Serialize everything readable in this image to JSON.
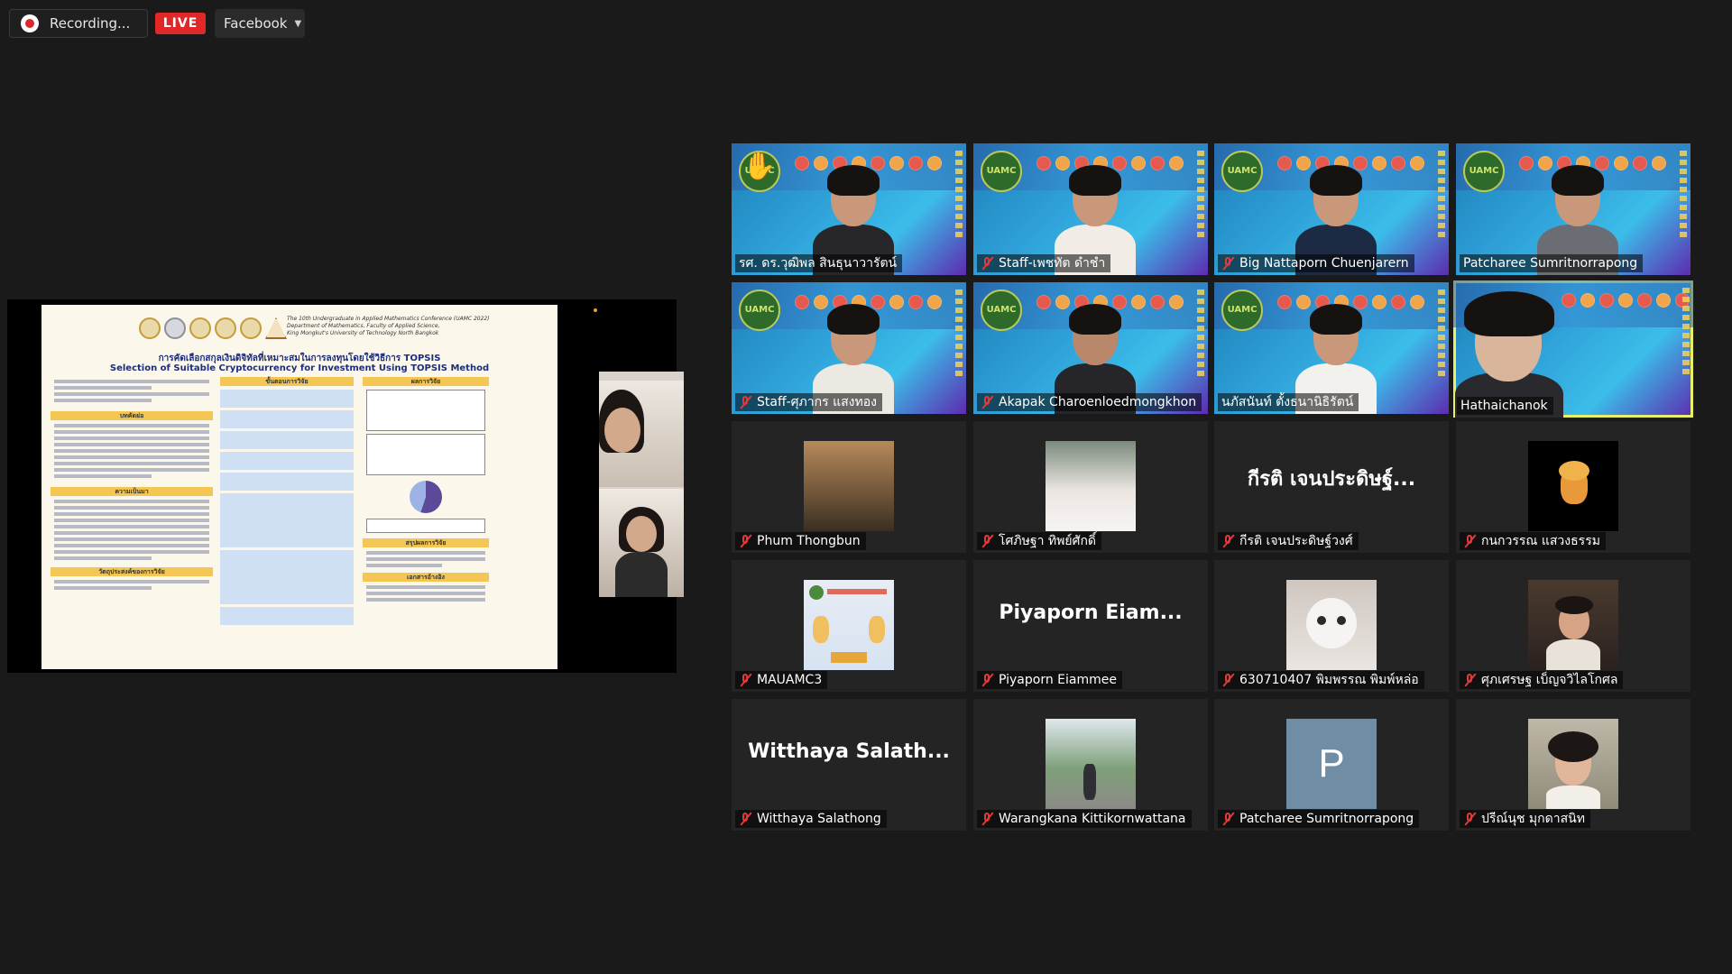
{
  "topbar": {
    "recording_label": "Recording...",
    "live_label": "LIVE",
    "stream_target": "Facebook"
  },
  "shared_screen": {
    "poster": {
      "conference": "The 10th Undergraduate in Applied Mathematics Conference (UAMC 2022)",
      "department": "Department of Mathematics, Faculty of Applied Science,",
      "university": "King Mongkut's University of Technology North Bangkok",
      "title_th": "การคัดเลือกสกุลเงินดิจิทัลที่เหมาะสมในการลงทุนโดยใช้วิธีการ TOPSIS",
      "title_en": "Selection of Suitable Cryptocurrency for Investment Using TOPSIS Method",
      "sections": [
        "บทคัดย่อ",
        "ความเป็นมา",
        "วัตถุประสงค์ของการวิจัย",
        "ขั้นตอนการวิจัย",
        "ผลการวิจัย",
        "สรุปผลการวิจัย",
        "เอกสารอ้างอิง"
      ]
    }
  },
  "participants": [
    {
      "name": "รศ. ดร.วุฒิพล สินธุนาวารัตน์",
      "type": "video",
      "muted": false,
      "hand_raised": true
    },
    {
      "name": "Staff-เพชทัต ดำชำ",
      "type": "video",
      "muted": true
    },
    {
      "name": "Big Nattaporn Chuenjarern",
      "type": "video",
      "muted": true
    },
    {
      "name": "Patcharee Sumritnorrapong",
      "type": "video",
      "muted": false
    },
    {
      "name": "Staff-ศุภากร แสงทอง",
      "type": "video",
      "muted": true
    },
    {
      "name": "Akapak Charoenloedmongkhon",
      "type": "video",
      "muted": true
    },
    {
      "name": "นภัสนันท์ ตั้งธนานิธิรัตน์",
      "type": "video",
      "muted": false
    },
    {
      "name": "Hathaichanok",
      "type": "video",
      "muted": false,
      "active_speaker": true
    },
    {
      "name": "Phum Thongbun",
      "type": "photo",
      "muted": true
    },
    {
      "name": "โศภิษฐา ทิพย์ศักดิ์",
      "type": "photo",
      "muted": true
    },
    {
      "name": "กีรติ เจนประดิษฐ์วงศ์",
      "type": "text",
      "display": "กีรติ เจนประดิษฐ์...",
      "muted": true
    },
    {
      "name": "กนกวรรณ แสวงธรรม",
      "type": "photo",
      "muted": true
    },
    {
      "name": "MAUAMC3",
      "type": "photo",
      "muted": true
    },
    {
      "name": "Piyaporn Eiammee",
      "type": "text",
      "display": "Piyaporn  Eiam...",
      "muted": true
    },
    {
      "name": "630710407 พิมพรรณ พิมพ์หล่อ",
      "type": "photo",
      "muted": true
    },
    {
      "name": "ศุภเศรษฐ เบ็ญจวิไลโกศล",
      "type": "photo",
      "muted": true
    },
    {
      "name": "Witthaya Salathong",
      "type": "text",
      "display": "Witthaya  Salath...",
      "muted": true
    },
    {
      "name": "Warangkana Kittikornwattana",
      "type": "photo",
      "muted": true
    },
    {
      "name": "Patcharee Sumritnorrapong",
      "type": "avatar",
      "letter": "P",
      "muted": true
    },
    {
      "name": "ปรีณ์นุช มุกดาสนิท",
      "type": "photo",
      "muted": true
    }
  ],
  "colors": {
    "background": "#1a1a1a",
    "tile": "#242424",
    "live": "#e02828",
    "muted_mic": "#e03a3a",
    "active_border": "#e8f06a"
  }
}
